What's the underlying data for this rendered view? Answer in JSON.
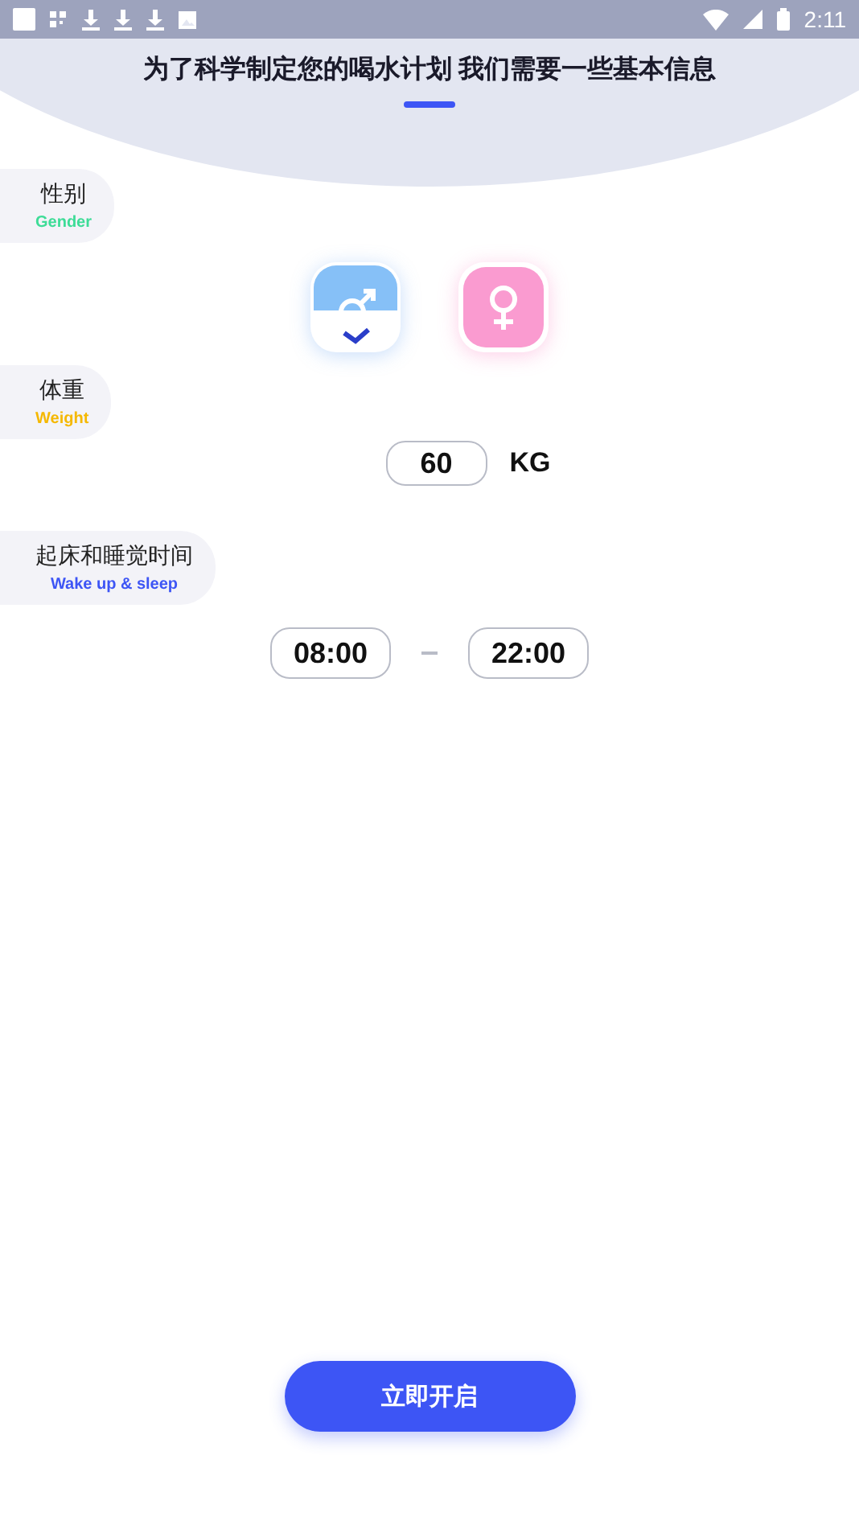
{
  "status_bar": {
    "time": "2:11"
  },
  "title": "为了科学制定您的喝水计划 我们需要一些基本信息",
  "gender": {
    "label": "性别",
    "sublabel": "Gender",
    "color": "#3ddc97",
    "options": [
      {
        "kind": "male",
        "selected": true
      },
      {
        "kind": "female",
        "selected": false
      }
    ]
  },
  "weight": {
    "label": "体重",
    "sublabel": "Weight",
    "color": "#f5b800",
    "value": "60",
    "unit": "KG"
  },
  "sleep": {
    "label": "起床和睡觉时间",
    "sublabel": "Wake up & sleep",
    "color": "#3d55f5",
    "wake_time": "08:00",
    "sleep_time": "22:00"
  },
  "start_button": "立即开启"
}
